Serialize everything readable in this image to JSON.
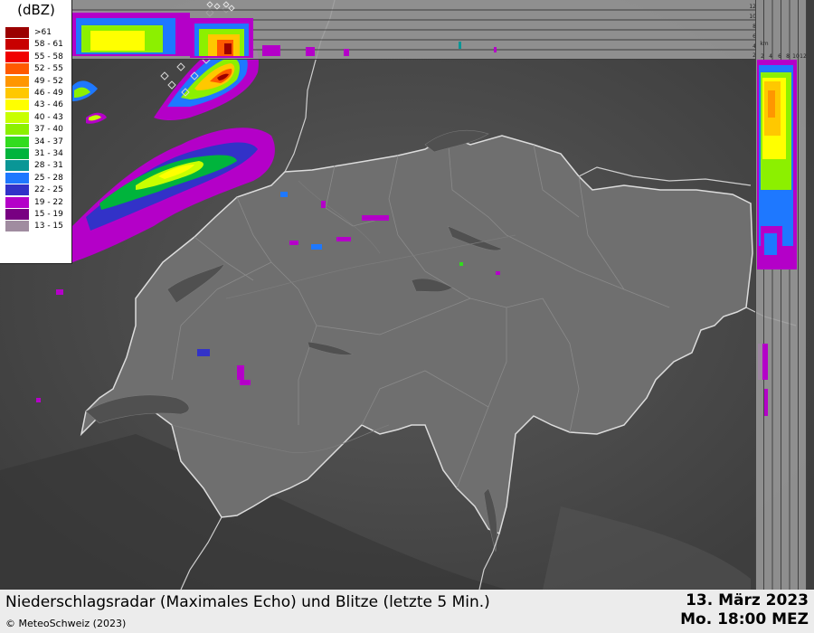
{
  "legend": {
    "title": "(dBZ)",
    "classes": [
      {
        "label": ">61",
        "color": "#9b0000"
      },
      {
        "label": "58 - 61",
        "color": "#c80000"
      },
      {
        "label": "55 - 58",
        "color": "#f00000"
      },
      {
        "label": "52 - 55",
        "color": "#ff5a00"
      },
      {
        "label": "49 - 52",
        "color": "#ff9600"
      },
      {
        "label": "46 - 49",
        "color": "#ffc800"
      },
      {
        "label": "43 - 46",
        "color": "#ffff00"
      },
      {
        "label": "40 - 43",
        "color": "#c8ff00"
      },
      {
        "label": "37 - 40",
        "color": "#8cf000"
      },
      {
        "label": "34 - 37",
        "color": "#32dc1e"
      },
      {
        "label": "31 - 34",
        "color": "#00b43c"
      },
      {
        "label": "28 - 31",
        "color": "#0a9696"
      },
      {
        "label": "25 - 28",
        "color": "#1e78ff"
      },
      {
        "label": "22 - 25",
        "color": "#3232c8"
      },
      {
        "label": "19 - 22",
        "color": "#b400c8"
      },
      {
        "label": "15 - 19",
        "color": "#780082"
      },
      {
        "label": "13 - 15",
        "color": "#a08ca0"
      }
    ]
  },
  "cross_sections": {
    "km_label": "km",
    "top_ticks": [
      "12",
      "10",
      "8",
      "6",
      "4",
      "2"
    ],
    "side_ticks": [
      "2",
      "4",
      "6",
      "8",
      "10",
      "12"
    ]
  },
  "footer": {
    "title": "Niederschlagsradar (Maximales Echo) und Blitze (letzte 5 Min.)",
    "copyright": "© MeteoSchweiz (2023)",
    "date": "13. März 2023",
    "time": "Mo. 18:00 MEZ"
  }
}
